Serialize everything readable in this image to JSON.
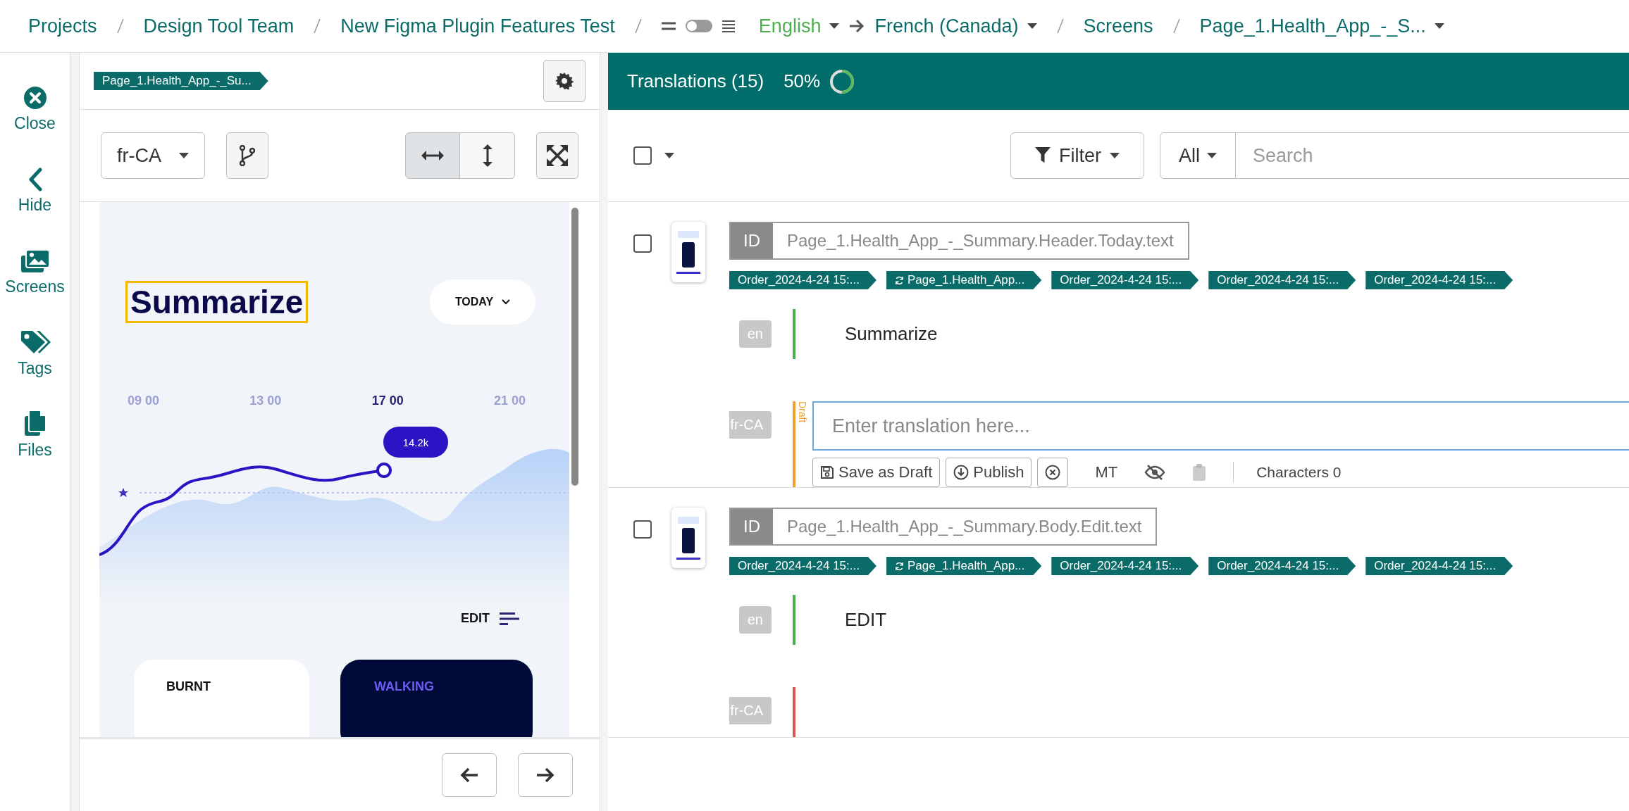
{
  "top_bar": {
    "crumbs": [
      "Projects",
      "Design Tool Team",
      "New Figma Plugin Features Test"
    ],
    "toggle_on": false,
    "source_language": "English",
    "target_language": "French (Canada)",
    "section": "Screens",
    "screen": "Page_1.Health_App_-_S..."
  },
  "sidebar": {
    "items": [
      {
        "label": "Close"
      },
      {
        "label": "Hide"
      },
      {
        "label": "Screens"
      },
      {
        "label": "Tags"
      },
      {
        "label": "Files"
      }
    ]
  },
  "preview": {
    "tag": "Page_1.Health_App_-_Su...",
    "locale": "fr-CA",
    "fit_modes": [
      {
        "selected": true
      },
      {
        "selected": false
      }
    ],
    "screen": {
      "title": "Summarize",
      "title_highlighted": true,
      "period": "TODAY",
      "times": [
        {
          "label": "09 00",
          "selected": false
        },
        {
          "label": "13 00",
          "selected": false
        },
        {
          "label": "17 00",
          "selected": true
        },
        {
          "label": "21 00",
          "selected": false
        }
      ],
      "bubble": "14.2k",
      "edit": "EDIT",
      "cards": [
        {
          "label": "BURNT",
          "kind": "light"
        },
        {
          "label": "WALKING",
          "kind": "dark"
        }
      ]
    }
  },
  "translations": {
    "title": "Translations (15)",
    "percent": "50%",
    "level": 0.5,
    "select_all_checked": false,
    "filter": "Filter",
    "scope": "All",
    "search_placeholder": "Search",
    "rows": [
      {
        "checked": false,
        "id_label": "ID",
        "key": "Page_1.Health_App_-_Summary.Header.Today.text",
        "tags": [
          {
            "label": "Order_2024-4-24 15:...",
            "kind": "order"
          },
          {
            "label": "Page_1.Health_App...",
            "kind": "screen"
          },
          {
            "label": "Order_2024-4-24 15:...",
            "kind": "order"
          },
          {
            "label": "Order_2024-4-24 15:...",
            "kind": "order"
          },
          {
            "label": "Order_2024-4-24 15:...",
            "kind": "order"
          }
        ],
        "lines": [
          {
            "kind": "source",
            "lang": "en",
            "text": "Summarize"
          },
          {
            "kind": "target",
            "lang": "fr-CA",
            "color": "#f0a030",
            "status_label": "Draft",
            "editor": {
              "placeholder": "Enter translation here...",
              "save": "Save as Draft",
              "publish": "Publish",
              "mt": "MT",
              "characters_label": "Characters",
              "characters": "0"
            }
          }
        ]
      },
      {
        "checked": false,
        "id_label": "ID",
        "key": "Page_1.Health_App_-_Summary.Body.Edit.text",
        "tags": [
          {
            "label": "Order_2024-4-24 15:...",
            "kind": "order"
          },
          {
            "label": "Page_1.Health_App...",
            "kind": "screen"
          },
          {
            "label": "Order_2024-4-24 15:...",
            "kind": "order"
          },
          {
            "label": "Order_2024-4-24 15:...",
            "kind": "order"
          },
          {
            "label": "Order_2024-4-24 15:...",
            "kind": "order"
          }
        ],
        "lines": [
          {
            "kind": "source",
            "lang": "en",
            "text": "EDIT"
          },
          {
            "kind": "target",
            "lang": "fr-CA",
            "color": "#d9534f"
          }
        ]
      }
    ]
  }
}
